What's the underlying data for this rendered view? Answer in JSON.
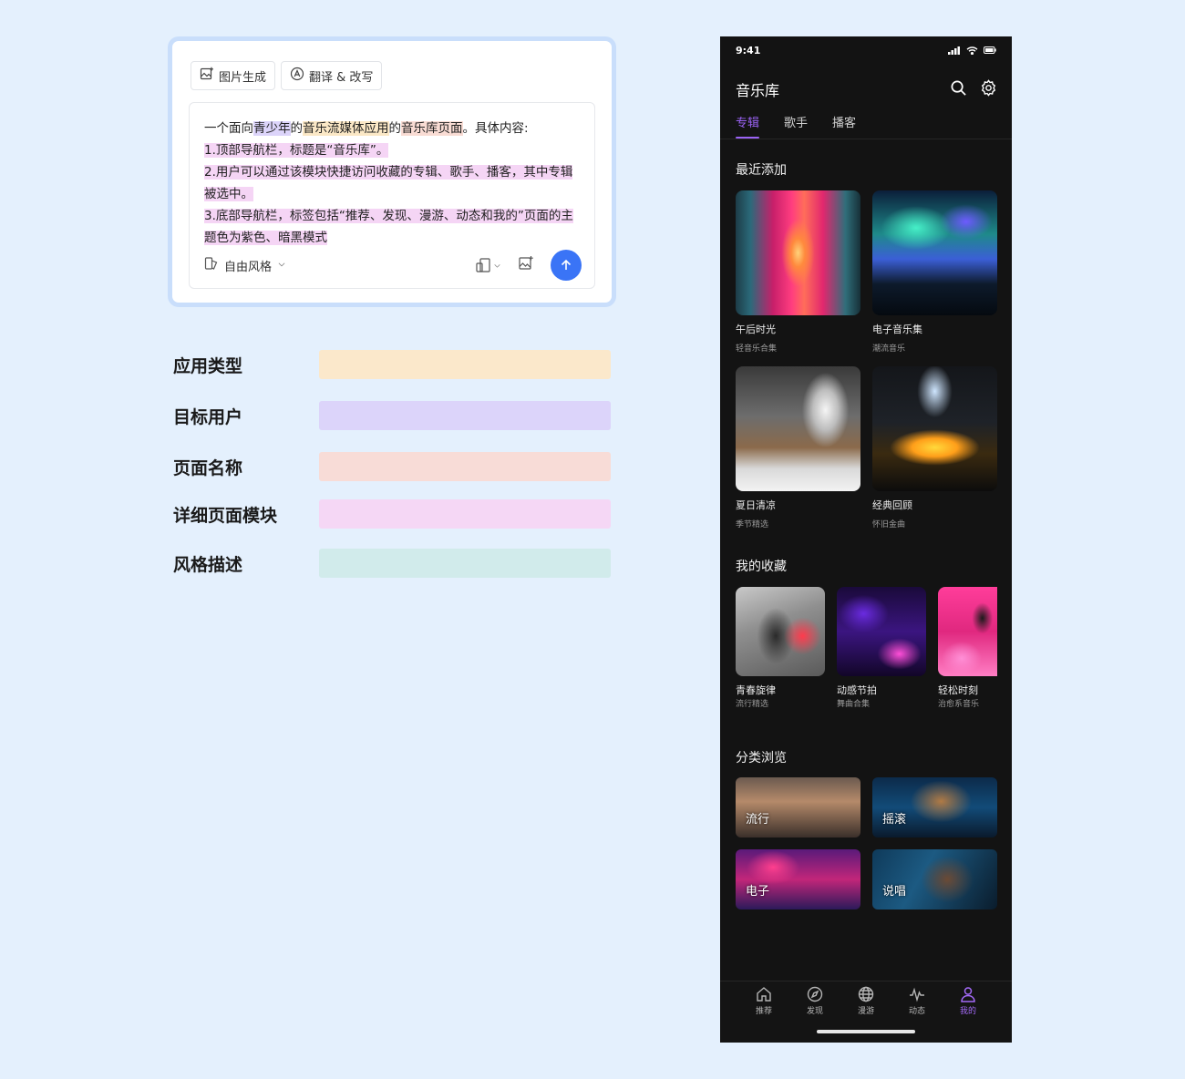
{
  "prompt_panel": {
    "tools": {
      "image_gen": "图片生成",
      "translate": "翻译 & 改写"
    },
    "text": {
      "line1_a": "一个面向",
      "line1_user": "青少年",
      "line1_b": "的",
      "line1_app": "音乐流媒体应用",
      "line1_c": "的",
      "line1_page": "音乐库页面",
      "line1_d": "。具体内容:",
      "module1": "1.顶部导航栏，标题是“音乐库”。",
      "module2": "2.用户可以通过该模块快捷访问收藏的专辑、歌手、播客，其中专辑被选中。",
      "module3": "3.底部导航栏，标签包括“推荐、发现、漫游、动态和我的”页面的主题色为紫色、暗黑模式"
    },
    "style_select": "自由风格"
  },
  "legend": [
    {
      "label": "应用类型",
      "color": "#fbe8cb"
    },
    {
      "label": "目标用户",
      "color": "#dcd4fa"
    },
    {
      "label": "页面名称",
      "color": "#f8dcd7"
    },
    {
      "label": "详细页面模块",
      "color": "#f5d7f5"
    },
    {
      "label": "风格描述",
      "color": "#d1ebeb"
    }
  ],
  "phone": {
    "status": {
      "time": "9:41"
    },
    "header": {
      "title": "音乐库"
    },
    "tabs": [
      "专辑",
      "歌手",
      "播客"
    ],
    "recent": {
      "title": "最近添加",
      "items": [
        {
          "title": "午后时光",
          "sub": "轻音乐合集"
        },
        {
          "title": "电子音乐集",
          "sub": "潮流音乐"
        },
        {
          "title": "夏日清凉",
          "sub": "季节精选"
        },
        {
          "title": "经典回顾",
          "sub": "怀旧金曲"
        }
      ]
    },
    "favorites": {
      "title": "我的收藏",
      "items": [
        {
          "title": "青春旋律",
          "sub": "流行精选"
        },
        {
          "title": "动感节拍",
          "sub": "舞曲合集"
        },
        {
          "title": "轻松时刻",
          "sub": "治愈系音乐"
        }
      ]
    },
    "categories": {
      "title": "分类浏览",
      "items": [
        "流行",
        "摇滚",
        "电子",
        "说唱"
      ]
    },
    "nav": [
      "推荐",
      "发现",
      "漫游",
      "动态",
      "我的"
    ],
    "colors": {
      "accent": "#9b63f5",
      "background": "#131313"
    }
  }
}
